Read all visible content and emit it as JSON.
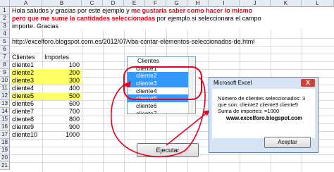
{
  "columns": [
    "A",
    "B",
    "C",
    "D",
    "E",
    "F",
    "G",
    "H",
    "I",
    "J",
    "K",
    "L"
  ],
  "rows": [
    "1",
    "2",
    "3",
    "4",
    "5",
    "6",
    "7",
    "8",
    "9",
    "10",
    "11",
    "12",
    "13",
    "14",
    "15",
    "16",
    "17",
    "18",
    "19",
    "20",
    "21"
  ],
  "note": {
    "line1_black": "Hola saludos y gracias por este ejemplo y ",
    "line1_red": "me gustaria saber como hacer lo mismo",
    "line2_red": "pero que me sume la cantidades seleccionadas",
    "line2_black": " por ejemplo si seleccionara el campo",
    "line3": "importe. Gracias"
  },
  "url": "http://excelforo.blogspot.com.es/2012/07/vba-contar-elementos-seleccionados-de.html",
  "table": {
    "headers": [
      "Clientes",
      "Importes"
    ],
    "rows": [
      {
        "cliente": "cliente1",
        "importe": "100",
        "highlight": false
      },
      {
        "cliente": "cliente2",
        "importe": "200",
        "highlight": true
      },
      {
        "cliente": "cliente3",
        "importe": "300",
        "highlight": true
      },
      {
        "cliente": "cliente4",
        "importe": "400",
        "highlight": false
      },
      {
        "cliente": "cliente5",
        "importe": "500",
        "highlight": true
      },
      {
        "cliente": "cliente6",
        "importe": "600",
        "highlight": false
      },
      {
        "cliente": "cliente7",
        "importe": "700",
        "highlight": false
      },
      {
        "cliente": "cliente8",
        "importe": "800",
        "highlight": false
      },
      {
        "cliente": "cliente9",
        "importe": "900",
        "highlight": false
      },
      {
        "cliente": "cliente10",
        "importe": "1000",
        "highlight": false
      }
    ]
  },
  "listbox": {
    "header": "Clientes",
    "items": [
      {
        "label": "cliente1",
        "selected": false
      },
      {
        "label": "cliente2",
        "selected": true
      },
      {
        "label": "cliente3",
        "selected": true
      },
      {
        "label": "cliente4",
        "selected": false
      },
      {
        "label": "cliente5",
        "selected": true
      },
      {
        "label": "cliente6",
        "selected": false
      },
      {
        "label": "cliente7",
        "selected": false
      }
    ]
  },
  "button_ejecutar": "Ejecutar",
  "msgbox": {
    "title": "Microsoft Excel",
    "close_glyph": "X",
    "line1": "Número de clientes seleccionados: 3",
    "line2": "que son:  cliente2 cliente3 cliente5",
    "line3": "Suma de importes: =1000",
    "blog": "www.excelforo.blogspot.com",
    "ok_label": "Aceptar"
  },
  "colors": {
    "highlight": "#ffff66",
    "selection": "#3399ff",
    "annotation": "#e8001c"
  }
}
